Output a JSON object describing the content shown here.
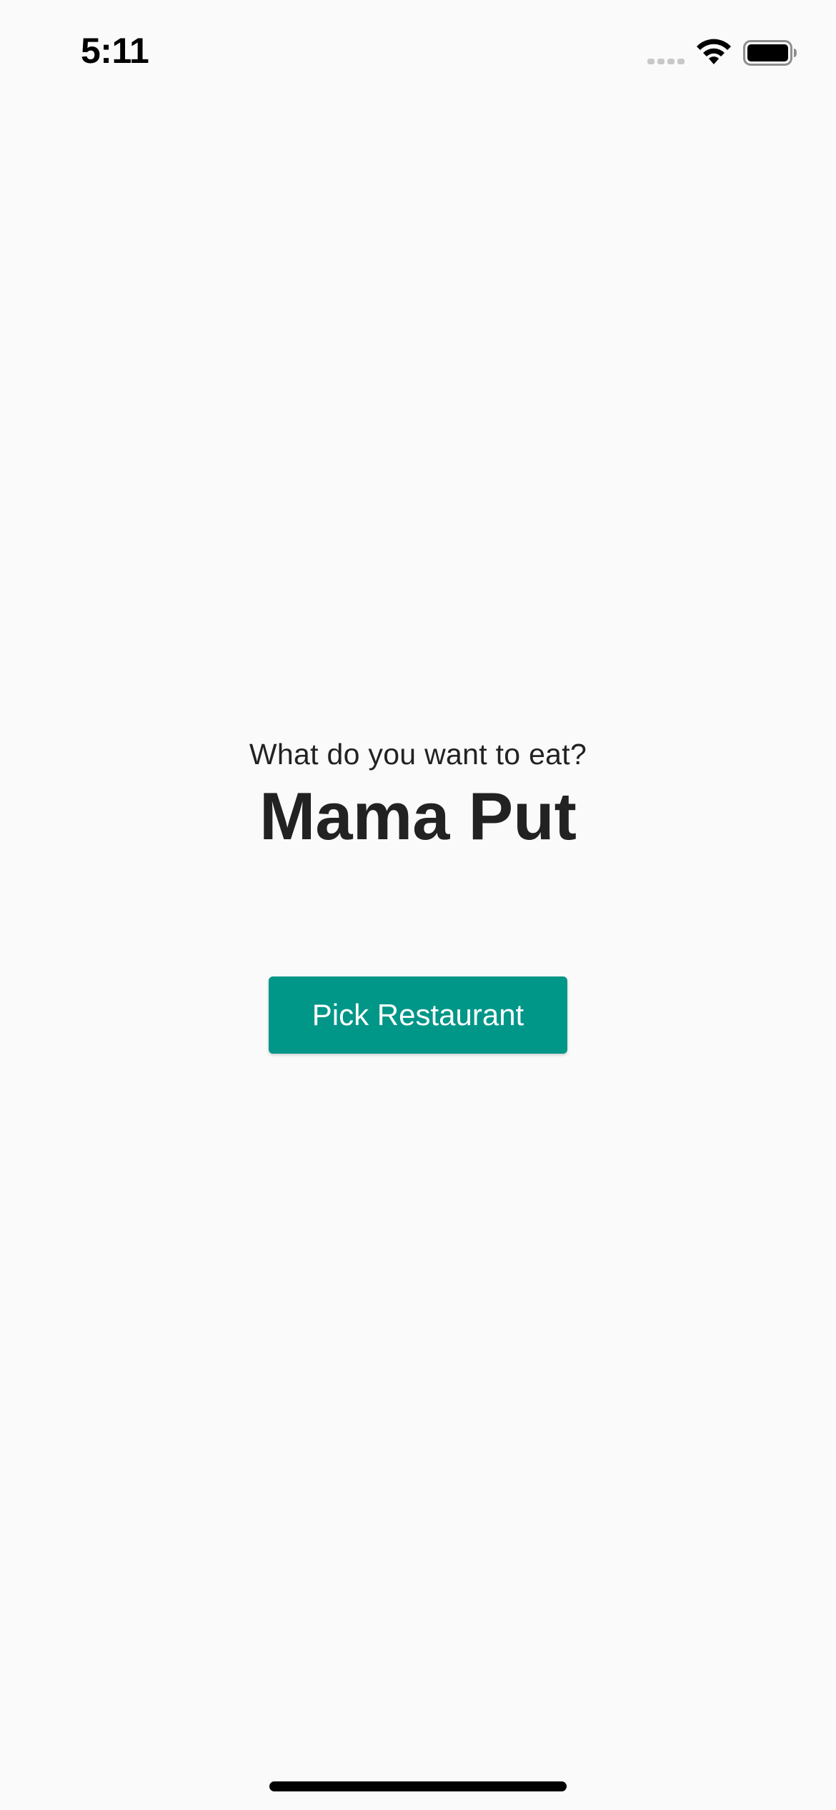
{
  "status_bar": {
    "time": "5:11",
    "icons": [
      "cellular-signal-icon",
      "wifi-icon",
      "battery-icon"
    ]
  },
  "main": {
    "prompt": "What do you want to eat?",
    "restaurant_name": "Mama Put",
    "pick_button_label": "Pick Restaurant"
  },
  "colors": {
    "background": "#fafafa",
    "text": "#222222",
    "accent": "#009688",
    "button_text": "#ffffff"
  }
}
